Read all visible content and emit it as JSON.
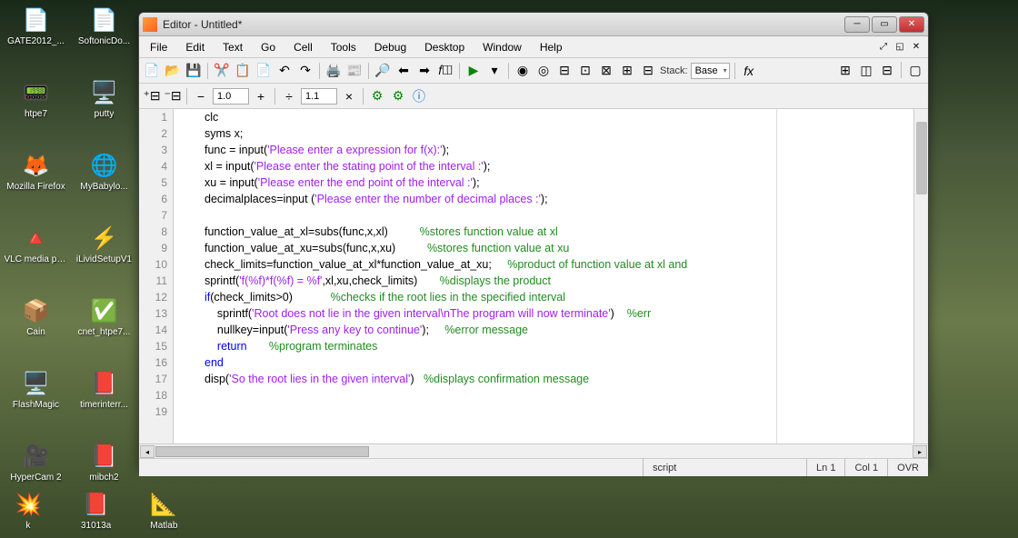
{
  "desktop_icons": [
    {
      "label": "GATE2012_...",
      "emoji": "📄",
      "col": 1,
      "row": 1
    },
    {
      "label": "SoftonicDo...",
      "emoji": "📄",
      "col": 2,
      "row": 1
    },
    {
      "label": "htpe7",
      "emoji": "📟",
      "col": 1,
      "row": 2
    },
    {
      "label": "putty",
      "emoji": "🖥️",
      "col": 2,
      "row": 2
    },
    {
      "label": "Mozilla Firefox",
      "emoji": "🦊",
      "col": 1,
      "row": 3
    },
    {
      "label": "MyBabylo...",
      "emoji": "🌐",
      "col": 2,
      "row": 3
    },
    {
      "label": "VLC media player",
      "emoji": "🔺",
      "col": 1,
      "row": 4
    },
    {
      "label": "iLividSetupV1",
      "emoji": "⚡",
      "col": 2,
      "row": 4
    },
    {
      "label": "Cain",
      "emoji": "📦",
      "col": 1,
      "row": 5
    },
    {
      "label": "cnet_htpe7...",
      "emoji": "✅",
      "col": 2,
      "row": 5
    },
    {
      "label": "FlashMagic",
      "emoji": "🖥️",
      "col": 1,
      "row": 6
    },
    {
      "label": "timerinterr...",
      "emoji": "📕",
      "col": 2,
      "row": 6
    },
    {
      "label": "HyperCam 2",
      "emoji": "🎥",
      "col": 1,
      "row": 7
    },
    {
      "label": "mibch2",
      "emoji": "📕",
      "col": 2,
      "row": 7
    }
  ],
  "bottom_icons": [
    {
      "label": "k",
      "emoji": "💥"
    },
    {
      "label": "31013a",
      "emoji": "📕"
    },
    {
      "label": "Matlab",
      "emoji": "📐"
    }
  ],
  "window": {
    "title": "Editor - Untitled*",
    "menus": [
      "File",
      "Edit",
      "Text",
      "Go",
      "Cell",
      "Tools",
      "Debug",
      "Desktop",
      "Window",
      "Help"
    ],
    "stack_label": "Stack:",
    "stack_value": "Base",
    "zoom1": "1.0",
    "zoom2": "1.1",
    "status_script": "script",
    "status_ln": "Ln  1",
    "status_col": "Col  1",
    "status_ovr": "OVR"
  },
  "code_lines": [
    {
      "n": 1,
      "segments": [
        {
          "t": "clc",
          "c": ""
        }
      ]
    },
    {
      "n": 2,
      "segments": [
        {
          "t": "syms ",
          "c": ""
        },
        {
          "t": "x;",
          "c": ""
        }
      ]
    },
    {
      "n": 3,
      "segments": [
        {
          "t": "func = input(",
          "c": ""
        },
        {
          "t": "'Please enter a expression for f(x):'",
          "c": "str"
        },
        {
          "t": ");",
          "c": ""
        }
      ]
    },
    {
      "n": 4,
      "segments": [
        {
          "t": "xl = input(",
          "c": ""
        },
        {
          "t": "'Please enter the stating point of the interval :'",
          "c": "str"
        },
        {
          "t": ");",
          "c": ""
        }
      ]
    },
    {
      "n": 5,
      "segments": [
        {
          "t": "xu = input(",
          "c": ""
        },
        {
          "t": "'Please enter the end point of the interval :'",
          "c": "str"
        },
        {
          "t": ");",
          "c": ""
        }
      ]
    },
    {
      "n": 6,
      "segments": [
        {
          "t": "decimalplaces=input (",
          "c": ""
        },
        {
          "t": "'Please enter the number of decimal places :'",
          "c": "str"
        },
        {
          "t": ");",
          "c": ""
        }
      ]
    },
    {
      "n": 7,
      "segments": []
    },
    {
      "n": 8,
      "segments": [
        {
          "t": "function_value_at_xl=subs(func,x,xl)          ",
          "c": ""
        },
        {
          "t": "%stores function value at xl",
          "c": "cmt"
        }
      ]
    },
    {
      "n": 9,
      "segments": [
        {
          "t": "function_value_at_xu=subs(func,x,xu)          ",
          "c": ""
        },
        {
          "t": "%stores function value at xu",
          "c": "cmt"
        }
      ]
    },
    {
      "n": 10,
      "segments": [
        {
          "t": "check_limits=function_value_at_xl*function_value_at_xu;     ",
          "c": ""
        },
        {
          "t": "%product of function value at xl and",
          "c": "cmt"
        }
      ]
    },
    {
      "n": 11,
      "segments": [
        {
          "t": "sprintf(",
          "c": ""
        },
        {
          "t": "'f(%f)*f(%f) = %f'",
          "c": "str"
        },
        {
          "t": ",xl,xu,check_limits)       ",
          "c": ""
        },
        {
          "t": "%displays the product",
          "c": "cmt"
        }
      ]
    },
    {
      "n": 12,
      "segments": [
        {
          "t": "if",
          "c": "kw"
        },
        {
          "t": "(check_limits>0)            ",
          "c": ""
        },
        {
          "t": "%checks if the root lies in the specified interval",
          "c": "cmt"
        }
      ]
    },
    {
      "n": 13,
      "segments": [
        {
          "t": "    sprintf(",
          "c": ""
        },
        {
          "t": "'Root does not lie in the given interval\\nThe program will now terminate'",
          "c": "str"
        },
        {
          "t": ")    ",
          "c": ""
        },
        {
          "t": "%err",
          "c": "cmt"
        }
      ]
    },
    {
      "n": 14,
      "segments": [
        {
          "t": "    nullkey=input(",
          "c": ""
        },
        {
          "t": "'Press any key to continue'",
          "c": "str"
        },
        {
          "t": ");     ",
          "c": ""
        },
        {
          "t": "%error message",
          "c": "cmt"
        }
      ]
    },
    {
      "n": 15,
      "segments": [
        {
          "t": "    ",
          "c": ""
        },
        {
          "t": "return",
          "c": "kw"
        },
        {
          "t": "       ",
          "c": ""
        },
        {
          "t": "%program terminates",
          "c": "cmt"
        }
      ]
    },
    {
      "n": 16,
      "segments": [
        {
          "t": "end",
          "c": "kw"
        }
      ]
    },
    {
      "n": 17,
      "segments": [
        {
          "t": "disp(",
          "c": ""
        },
        {
          "t": "'So the root lies in the given interval'",
          "c": "str"
        },
        {
          "t": ")   ",
          "c": ""
        },
        {
          "t": "%displays confirmation message",
          "c": "cmt"
        }
      ]
    },
    {
      "n": 18,
      "segments": []
    },
    {
      "n": 19,
      "segments": []
    }
  ]
}
